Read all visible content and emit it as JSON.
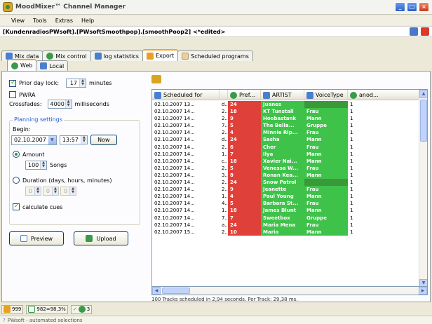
{
  "window": {
    "title": "MoodMixer™ Channel Manager"
  },
  "menu": [
    "View",
    "Tools",
    "Extras",
    "Help"
  ],
  "document_title": "[KundenradiosPWsoft].[PWsoftSmoothpop].[smoothPoop2] <*edited>",
  "tabs": [
    {
      "label": "Mix data",
      "icon": "list-icon"
    },
    {
      "label": "Mix control",
      "icon": "music-icon"
    },
    {
      "label": "log statistics",
      "icon": "bar-chart-icon"
    },
    {
      "label": "Export",
      "icon": "export-icon",
      "active": true
    },
    {
      "label": "Scheduled programs",
      "icon": "calendar-icon"
    }
  ],
  "subtabs": [
    {
      "label": "Web",
      "active": true
    },
    {
      "label": "Local"
    }
  ],
  "settings": {
    "prior_day_lock_label": "Prior day lock:",
    "prior_day_lock_value": "17",
    "prior_day_lock_unit": "minutes",
    "pwra_label": "PWRA",
    "crossfades_label": "Crossfades:",
    "crossfades_value": "4000",
    "crossfades_unit": "milliseconds",
    "planning_group_title": "Planning settings",
    "begin_label": "Begin:",
    "begin_date": "02.10.2007",
    "begin_time": "13:57",
    "now_button": "Now",
    "amount_label": "Amount",
    "amount_value": "100",
    "songs_label": "Songs",
    "duration_label": "Duration (days, hours, minutes)",
    "duration_days": "0",
    "duration_hours": "0",
    "duration_minutes": "0",
    "calculate_cues_label": "calculate cues",
    "preview_button": "Preview",
    "upload_button": "Upload"
  },
  "grid": {
    "columns": [
      "Scheduled for",
      "Pref...",
      "ARTIST",
      "VoiceType",
      "anod..."
    ],
    "rows": [
      {
        "time": "02.10.2007 13...",
        "s": "d..",
        "pref": "24",
        "artist": "Juanes",
        "voice": "",
        "n": "1"
      },
      {
        "time": "02.10.2007 14...",
        "s": "2..",
        "pref": "18",
        "artist": "KT Tunstall",
        "voice": "Frau",
        "n": "1"
      },
      {
        "time": "02.10.2007 14...",
        "s": "2..",
        "pref": "9",
        "artist": "Hoobastank",
        "voice": "Mann",
        "n": "1"
      },
      {
        "time": "02.10.2007 14...",
        "s": "7..",
        "pref": "5",
        "artist": "The Bella...",
        "voice": "Gruppe",
        "n": "1"
      },
      {
        "time": "02.10.2007 14...",
        "s": "2..",
        "pref": "4",
        "artist": "Minnie Rip...",
        "voice": "Frau",
        "n": "1"
      },
      {
        "time": "02.10.2007 14...",
        "s": "d..",
        "pref": "24",
        "artist": "Sasha",
        "voice": "Mann",
        "n": "1"
      },
      {
        "time": "02.10.2007 14...",
        "s": "2..",
        "pref": "6",
        "artist": "Cher",
        "voice": "Frau",
        "n": "1"
      },
      {
        "time": "02.10.2007 14...",
        "s": "1..",
        "pref": "7",
        "artist": "Ilya",
        "voice": "Mann",
        "n": "1"
      },
      {
        "time": "02.10.2007 14...",
        "s": "c..",
        "pref": "18",
        "artist": "Xavier Nai...",
        "voice": "Mann",
        "n": "1"
      },
      {
        "time": "02.10.2007 14...",
        "s": "2..",
        "pref": "5",
        "artist": "Venessa W...",
        "voice": "Frau",
        "n": "1"
      },
      {
        "time": "02.10.2007 14...",
        "s": "3..",
        "pref": "8",
        "artist": "Ronan Kea...",
        "voice": "Mann",
        "n": "1"
      },
      {
        "time": "02.10.2007 14...",
        "s": "2..",
        "pref": "24",
        "artist": "Snow Patrol",
        "voice": "",
        "n": "1"
      },
      {
        "time": "02.10.2007 14...",
        "s": "2..",
        "pref": "9",
        "artist": "Jeanette",
        "voice": "Frau",
        "n": "1"
      },
      {
        "time": "02.10.2007 14...",
        "s": "1..",
        "pref": "4",
        "artist": "Paul Young",
        "voice": "Mann",
        "n": "1"
      },
      {
        "time": "02.10.2007 14...",
        "s": "4..",
        "pref": "5",
        "artist": "Barbara St...",
        "voice": "Frau",
        "n": "1"
      },
      {
        "time": "02.10.2007 14...",
        "s": "1..",
        "pref": "18",
        "artist": "James Blunt",
        "voice": "Mann",
        "n": "1"
      },
      {
        "time": "02.10.2007 14...",
        "s": "7..",
        "pref": "7",
        "artist": "Sweetbox",
        "voice": "Gruppe",
        "n": "1"
      },
      {
        "time": "02.10.2007 14...",
        "s": "a..",
        "pref": "24",
        "artist": "Maria Mena",
        "voice": "Frau",
        "n": "1"
      },
      {
        "time": "02.10.2007 15...",
        "s": "2..",
        "pref": "10",
        "artist": "Mario",
        "voice": "Mann",
        "n": "1"
      }
    ]
  },
  "status_text": "100 Tracks scheduled in 2,94 seconds. Per Track: 29,38 ms.",
  "statusbar": {
    "count": "999",
    "percent": "982=98,3%",
    "checks": "3"
  },
  "taskbar_text": "PWsoft - automated selections",
  "colors": {
    "red": "#e0403a",
    "green": "#3fc24a",
    "accent": "#f7a31f"
  }
}
